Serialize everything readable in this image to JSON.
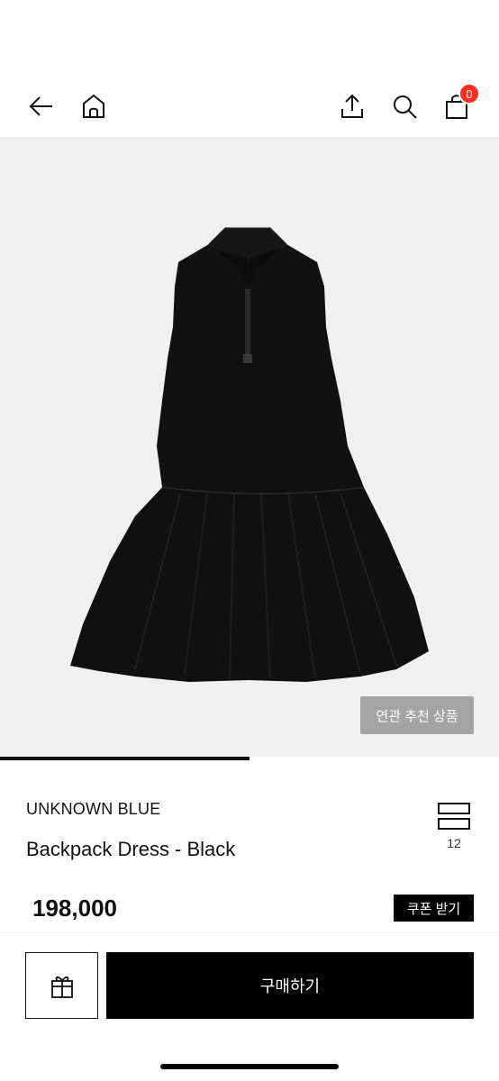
{
  "nav": {
    "back_icon": "arrow-left-icon",
    "home_icon": "home-icon",
    "share_icon": "share-icon",
    "search_icon": "search-icon",
    "cart_icon": "shopping-bag-icon",
    "cart_count": "0",
    "badge_color": "#ff2d20"
  },
  "gallery": {
    "related_label": "연관 추천 상품",
    "progress": 0.5
  },
  "product": {
    "brand": "UNKNOWN BLUE",
    "name": "Backpack Dress - Black",
    "like_icon": "bookmark-icon",
    "like_count": "12",
    "price": "198,000",
    "coupon_label": "쿠폰 받기"
  },
  "bottom": {
    "gift_icon": "gift-icon",
    "buy_label": "구매하기"
  }
}
